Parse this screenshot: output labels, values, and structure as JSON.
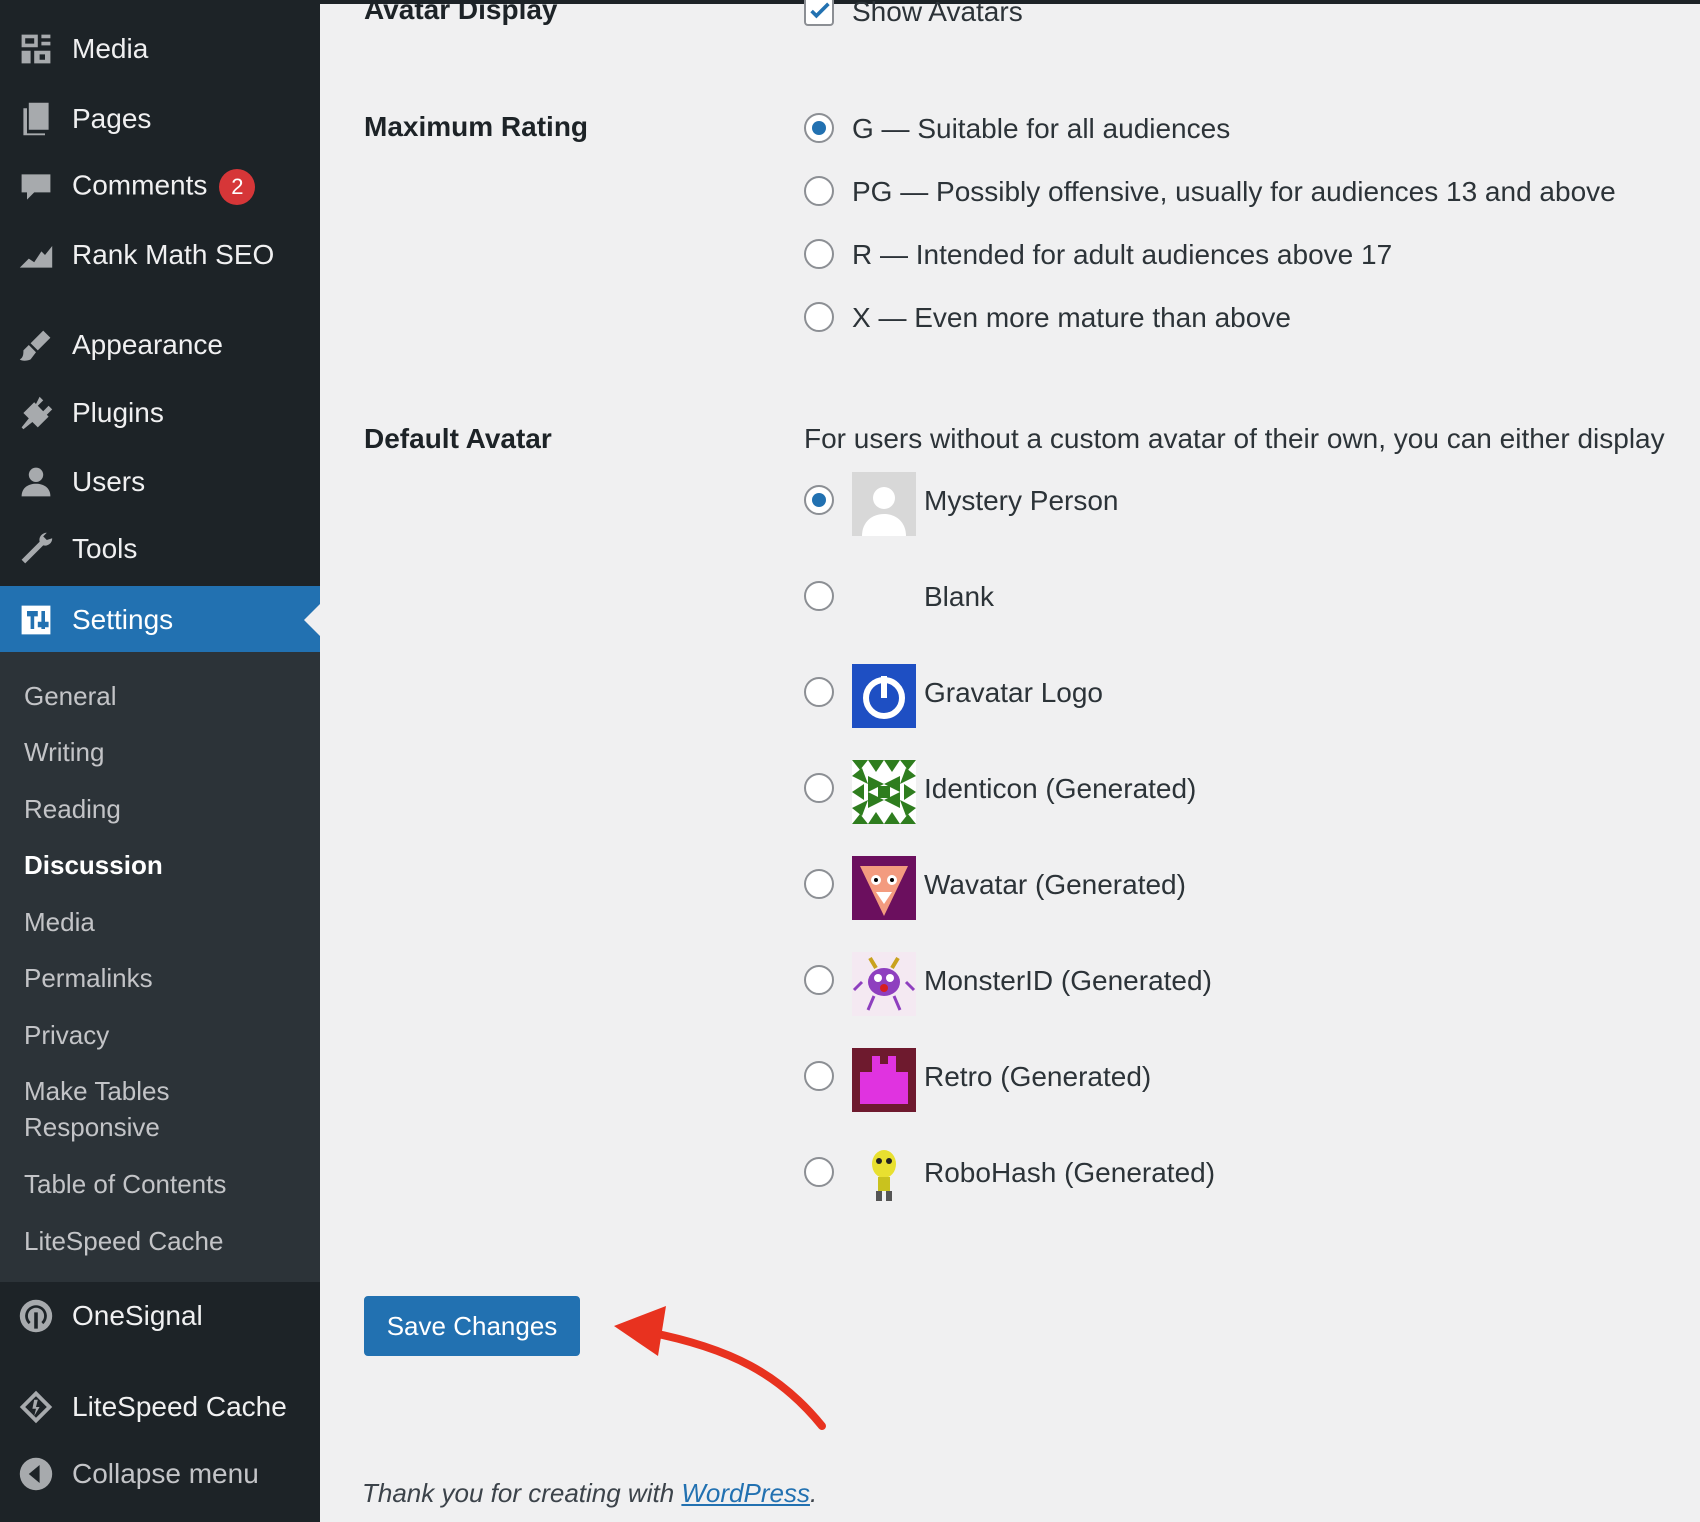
{
  "sidebar": {
    "items": [
      {
        "label": "Media",
        "icon": "media-icon"
      },
      {
        "label": "Pages",
        "icon": "pages-icon"
      },
      {
        "label": "Comments",
        "icon": "comments-icon",
        "badge": "2"
      },
      {
        "label": "Rank Math SEO",
        "icon": "rank-math-icon"
      },
      {
        "label": "Appearance",
        "icon": "appearance-icon"
      },
      {
        "label": "Plugins",
        "icon": "plugins-icon"
      },
      {
        "label": "Users",
        "icon": "users-icon"
      },
      {
        "label": "Tools",
        "icon": "tools-icon"
      },
      {
        "label": "Settings",
        "icon": "settings-icon",
        "active": true
      },
      {
        "label": "OneSignal",
        "icon": "onesignal-icon"
      },
      {
        "label": "LiteSpeed Cache",
        "icon": "litespeed-icon"
      },
      {
        "label": "Collapse menu",
        "icon": "collapse-icon"
      }
    ],
    "submenu": [
      "General",
      "Writing",
      "Reading",
      "Discussion",
      "Media",
      "Permalinks",
      "Privacy",
      "Make Tables",
      "Responsive",
      "Table of Contents",
      "LiteSpeed Cache"
    ],
    "submenu_current": "Discussion"
  },
  "main": {
    "avatar_display": {
      "label": "Avatar Display",
      "checkbox_label": "Show Avatars",
      "checked": true
    },
    "max_rating": {
      "label": "Maximum Rating",
      "options": [
        "G — Suitable for all audiences",
        "PG — Possibly offensive, usually for audiences 13 and above",
        "R — Intended for adult audiences above 17",
        "X — Even more mature than above"
      ],
      "selected": 0
    },
    "default_avatar": {
      "label": "Default Avatar",
      "description": "For users without a custom avatar of their own, you can either display",
      "options": [
        "Mystery Person",
        "Blank",
        "Gravatar Logo",
        "Identicon (Generated)",
        "Wavatar (Generated)",
        "MonsterID (Generated)",
        "Retro (Generated)",
        "RoboHash (Generated)"
      ],
      "selected": 0
    },
    "save_label": "Save Changes",
    "footer": {
      "text": "Thank you for creating with ",
      "link": "WordPress",
      "suffix": "."
    }
  },
  "colors": {
    "sidebar_bg": "#1d2327",
    "submenu_bg": "#2c3338",
    "accent": "#2271b1",
    "annotation_arrow": "#e8321f",
    "badge": "#d63638"
  }
}
